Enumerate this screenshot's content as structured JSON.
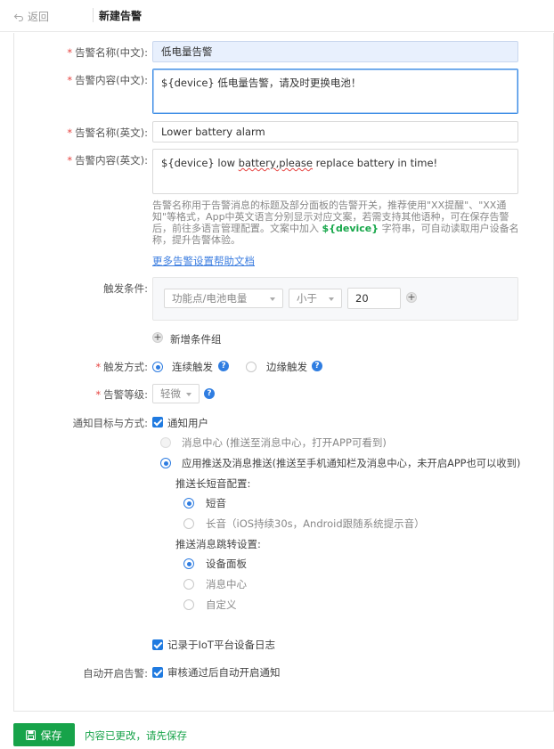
{
  "topbar": {
    "back_label": "返回",
    "title": "新建告警"
  },
  "form": {
    "name_cn": {
      "label": "告警名称(中文):",
      "value": "低电量告警"
    },
    "content_cn": {
      "label": "告警内容(中文):",
      "value": "${device} 低电量告警，请及时更换电池！"
    },
    "name_en": {
      "label": "告警名称(英文):",
      "value": "Lower battery alarm"
    },
    "content_en": {
      "label": "告警内容(英文):",
      "value_prefix": "${device} low ",
      "value_misspelled": "battery,please",
      "value_suffix": " replace battery in time!"
    },
    "hint": {
      "part1": "告警名称用于告警消息的标题及部分面板的告警开关，推荐使用\"XX提醒\"、\"XX通知\"等格式，App中英文语言分别显示对应文案，若需支持其他语种，可在保存告警后，前往多语言管理配置。文案中加入 ",
      "token": "${device}",
      "part2": " 字符串，可自动读取用户设备名称，提升告警体验。"
    },
    "help_link": "更多告警设置帮助文档",
    "trigger_condition": {
      "label": "触发条件:",
      "datapoint": "功能点/电池电量",
      "operator": "小于",
      "value": "20",
      "add_group": "新增条件组"
    },
    "trigger_mode": {
      "label": "触发方式:",
      "options": [
        "连续触发",
        "边缘触发"
      ],
      "selected": "连续触发"
    },
    "alarm_level": {
      "label": "告警等级:",
      "value": "轻微"
    },
    "notify": {
      "label": "通知目标与方式:",
      "notify_user": "通知用户",
      "options": [
        "消息中心 (推送至消息中心，打开APP可看到)",
        "应用推送及消息推送(推送至手机通知栏及消息中心，未开启APP也可以收到)"
      ],
      "push_sound_title": "推送长短音配置:",
      "sound_options": [
        "短音",
        "长音（iOS持续30s，Android跟随系统提示音）"
      ],
      "jump_title": "推送消息跳转设置:",
      "jump_options": [
        "设备面板",
        "消息中心",
        "自定义"
      ],
      "log_option": "记录于IoT平台设备日志"
    },
    "auto_enable": {
      "label": "自动开启告警:",
      "option": "审核通过后自动开启通知"
    }
  },
  "footer": {
    "save_label": "保存",
    "unsaved_msg": "内容已更改，请先保存"
  },
  "colors": {
    "primary": "#2f7de1",
    "save_green": "#17a34a",
    "required_red": "#e64340"
  }
}
